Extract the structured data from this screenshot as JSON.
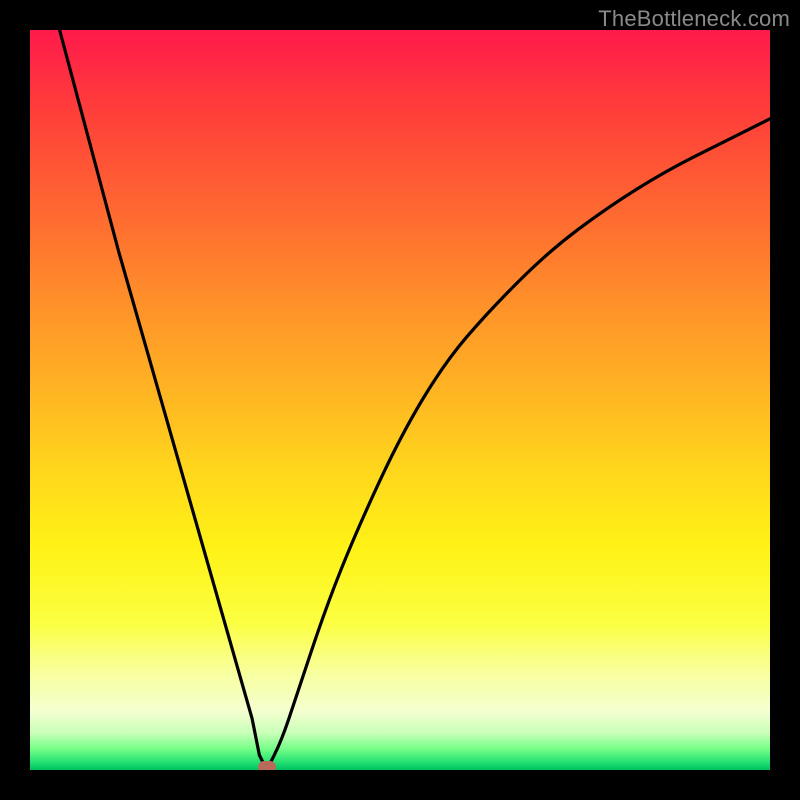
{
  "watermark": "TheBottleneck.com",
  "colors": {
    "frame": "#000000",
    "curve": "#000000",
    "vertex_dot": "#b96a5a",
    "gradient_stops": [
      "#ff1a4b",
      "#ff3b3b",
      "#ff5a34",
      "#ff7a2e",
      "#ff9a28",
      "#ffb822",
      "#ffd81c",
      "#fff216",
      "#fbff40",
      "#f8ffa0",
      "#f5ffd0",
      "#c8ffb8",
      "#7cff8a",
      "#20e070",
      "#00c060"
    ]
  },
  "chart_data": {
    "type": "line",
    "title": "",
    "xlabel": "",
    "ylabel": "",
    "xlim": [
      0,
      100
    ],
    "ylim": [
      0,
      100
    ],
    "grid": false,
    "legend": false,
    "vertex": {
      "x": 32,
      "y": 0
    },
    "series": [
      {
        "name": "left-branch",
        "x": [
          4,
          8,
          12,
          16,
          20,
          24,
          28,
          30,
          31,
          32
        ],
        "y": [
          100,
          85,
          70,
          56,
          42,
          28,
          14,
          7,
          2,
          0
        ]
      },
      {
        "name": "right-branch",
        "x": [
          32,
          34,
          36,
          40,
          44,
          50,
          56,
          62,
          70,
          78,
          86,
          94,
          100
        ],
        "y": [
          0,
          4,
          10,
          22,
          32,
          45,
          55,
          62,
          70,
          76,
          81,
          85,
          88
        ]
      }
    ],
    "notes": "V-shaped curve touching zero near x≈32; right branch rises with diminishing slope. Background is a vertical red→orange→yellow→green gradient. Values estimated from pixels on a 0–100 normalized axis."
  }
}
